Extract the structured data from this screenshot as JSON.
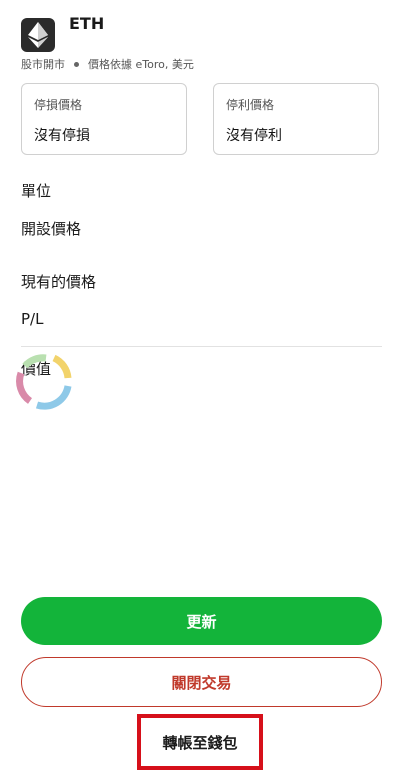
{
  "asset": {
    "name": "ETH",
    "icon": "ethereum-icon",
    "market_status": "股市開市",
    "price_source": "價格依據 eToro, 美元"
  },
  "stop_loss": {
    "label": "停損價格",
    "value": "沒有停損"
  },
  "take_profit": {
    "label": "停利價格",
    "value": "沒有停利"
  },
  "rows": {
    "units": "單位",
    "open_price": "開設價格",
    "current_price": "現有的價格",
    "pl": "P/L",
    "value": "價值"
  },
  "buttons": {
    "update": "更新",
    "close_trade": "關閉交易",
    "transfer_to_wallet": "轉帳至錢包"
  },
  "colors": {
    "primary_green": "#13b43a",
    "close_red": "#c0392b",
    "highlight_red": "#d6101a",
    "spinner": [
      "#f2d36b",
      "#8ec9e8",
      "#d98aa9",
      "#b9e0b0"
    ]
  }
}
